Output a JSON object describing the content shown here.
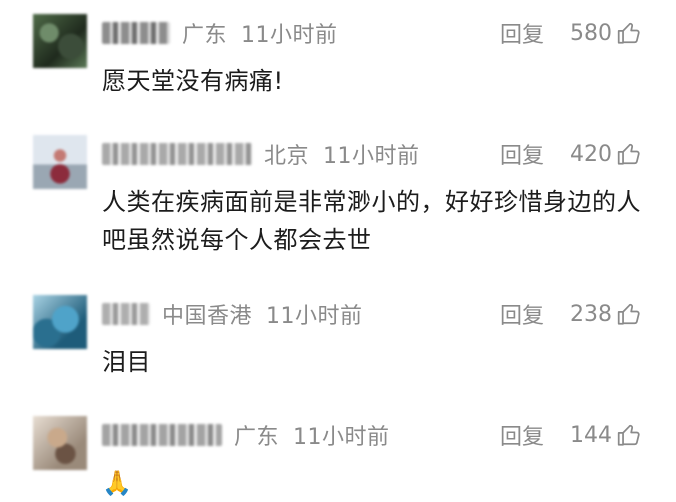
{
  "comments": [
    {
      "username": "",
      "location": "广东",
      "time": "11小时前",
      "reply_label": "回复",
      "likes": "580",
      "text": "愿天堂没有病痛!"
    },
    {
      "username": "",
      "location": "北京",
      "time": "11小时前",
      "reply_label": "回复",
      "likes": "420",
      "text": "人类在疾病面前是非常渺小的，好好珍惜身边的人吧虽然说每个人都会去世"
    },
    {
      "username": "",
      "location": "中国香港",
      "time": "11小时前",
      "reply_label": "回复",
      "likes": "238",
      "text": "泪目"
    },
    {
      "username": "",
      "location": "广东",
      "time": "11小时前",
      "reply_label": "回复",
      "likes": "144",
      "text": "🙏"
    }
  ],
  "icons": {
    "like": "thumbs-up-icon"
  },
  "colors": {
    "meta_text": "#8a8a8a",
    "body_text": "#1c1c1c",
    "background": "#ffffff"
  }
}
